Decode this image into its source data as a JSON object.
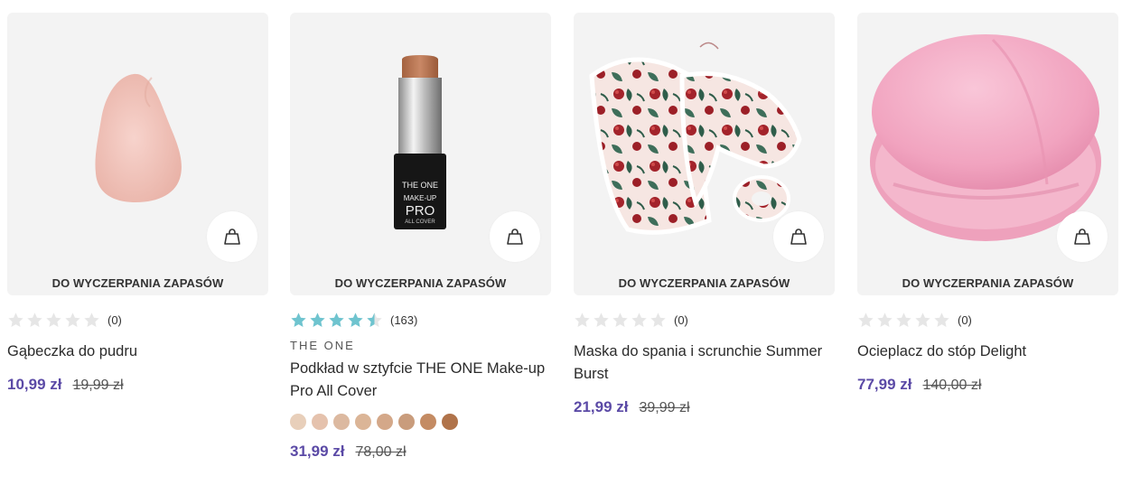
{
  "badge_text": "DO WYCZERPANIA ZAPASÓW",
  "colors": {
    "price": "#5b4aa6",
    "star_filled": "#6fc4cf",
    "star_empty": "#e6e6e6",
    "tile_bg": "#f3f3f3"
  },
  "products": [
    {
      "name": "Gąbeczka do pudru",
      "brand": "",
      "rating_value": 0,
      "rating_count": "(0)",
      "price_new": "10,99 zł",
      "price_old": "19,99 zł",
      "image": "makeup-sponge"
    },
    {
      "name": "Podkład w sztyfcie THE ONE Make-up Pro All Cover",
      "brand": "THE ONE",
      "rating_value": 4.5,
      "rating_count": "(163)",
      "price_new": "31,99 zł",
      "price_old": "78,00 zł",
      "image": "foundation-stick",
      "product_label": [
        "THE ONE",
        "MAKE-UP",
        "PRO",
        "ALL COVER"
      ],
      "swatches": [
        "#e8cfba",
        "#e5c2ad",
        "#dcb9a0",
        "#dbb597",
        "#d4a889",
        "#c99c7c",
        "#c48b63",
        "#b0734a"
      ]
    },
    {
      "name": "Maska do spania i scrunchie Summer Burst",
      "brand": "",
      "rating_value": 0,
      "rating_count": "(0)",
      "price_new": "21,99 zł",
      "price_old": "39,99 zł",
      "image": "floral-sleep-mask"
    },
    {
      "name": "Ocieplacz do stóp Delight",
      "brand": "",
      "rating_value": 0,
      "rating_count": "(0)",
      "price_new": "77,99 zł",
      "price_old": "140,00 zł",
      "image": "pink-foot-warmer"
    }
  ]
}
